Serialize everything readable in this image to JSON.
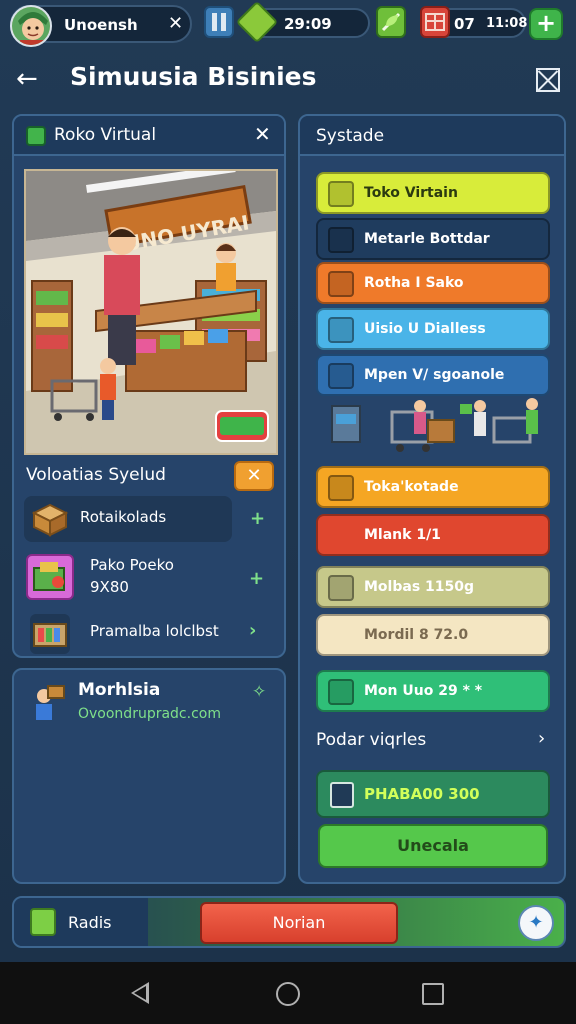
{
  "topbar": {
    "player_name": "Unoensh",
    "timer": "29:09",
    "counter": "07",
    "clock": "11:08"
  },
  "header": {
    "title": "Simuusia Bisinies"
  },
  "left_panel": {
    "title": "Roko Virtual",
    "scene_sign": "UNO UYRAI",
    "sales_title": "Voloatias Syelud",
    "sales": [
      {
        "label": "Rotaikolads",
        "icon": "box-icon"
      },
      {
        "label": "Pako Poeko",
        "sublabel": "9X80",
        "icon": "goods-icon"
      },
      {
        "label": "Pramalba lolclbst",
        "icon": "shelf-icon"
      }
    ]
  },
  "news_panel": {
    "title": "Morhlsia",
    "subtitle": "Ovoondrupradc.com"
  },
  "right_panel": {
    "title": "Systade",
    "items": [
      {
        "label": "Toko Virtain",
        "bg": "#d8ec3a",
        "fg": "#2b3a10",
        "icon": "coins-icon"
      },
      {
        "label": "Metarle Bottdar",
        "bg": "#1f3c5e",
        "fg": "#ffffff",
        "icon": "bricks-icon"
      },
      {
        "label": "Rotha I Sako",
        "bg": "#ef7a2a",
        "fg": "#ffffff",
        "icon": "cart-icon"
      },
      {
        "label": "Uisio U Dialless",
        "bg": "#4ab4e8",
        "fg": "#ffffff",
        "icon": "crate-icon"
      },
      {
        "label": "Mpen V/ sgoanole",
        "bg": "#2f6fb0",
        "fg": "#ffffff",
        "icon": "package-icon"
      },
      {
        "label": "Toka'kotade",
        "bg": "#f5a623",
        "fg": "#ffffff",
        "icon": "stack-icon"
      },
      {
        "label": "Mlank 1/1",
        "bg": "#e0472f",
        "fg": "#ffffff",
        "icon": ""
      },
      {
        "label": "Molbas 1150g",
        "bg": "#c6c88a",
        "fg": "#ffffff",
        "icon": "hex-icon"
      },
      {
        "label": "Mordil 8 72.0",
        "bg": "#f4e6c2",
        "fg": "#7a6a50",
        "icon": ""
      },
      {
        "label": "Mon Uuo 29 * *",
        "bg": "#2fbf78",
        "fg": "#ffffff",
        "icon": "register-icon"
      }
    ],
    "sub_title": "Podar viqrles",
    "price": "PHABA00 300",
    "unlock": "Unecala"
  },
  "bottom_bar": {
    "left_label": "Radis",
    "middle_label": "Norian"
  },
  "colors": {
    "background": "#1c324a",
    "panel": "#26446a",
    "accent_green": "#55c84b",
    "accent_red": "#e0472f"
  }
}
